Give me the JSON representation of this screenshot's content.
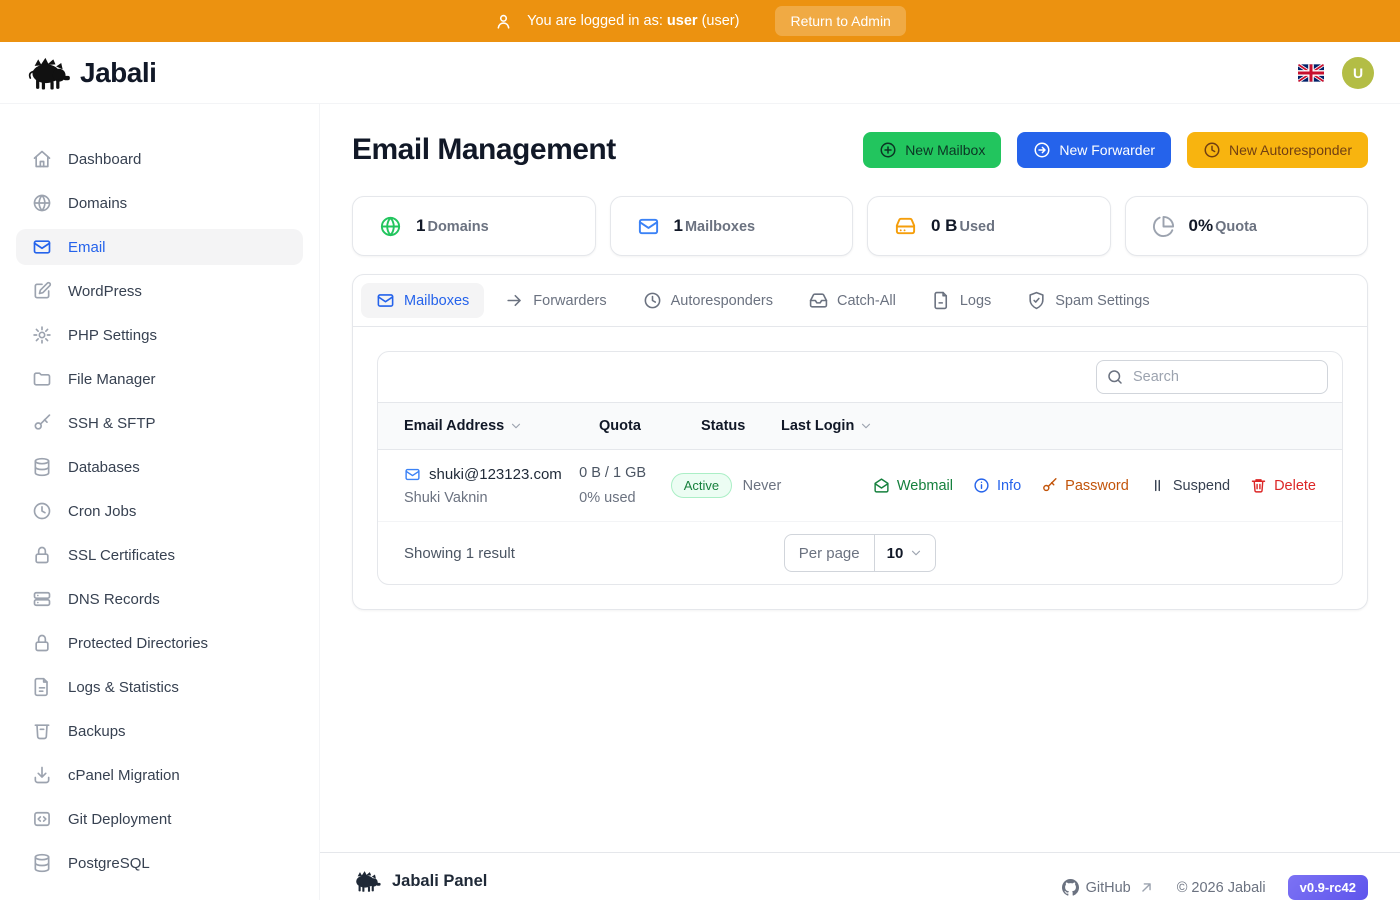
{
  "topbar": {
    "message_prefix": "You are logged in as:",
    "username": "user",
    "role_suffix": "(user)",
    "return_button": "Return to Admin"
  },
  "header": {
    "brand": "Jabali",
    "language_flag": "uk-flag",
    "avatar_initial": "U"
  },
  "sidebar": {
    "items": [
      {
        "label": "Dashboard",
        "icon": "home-icon",
        "active": false
      },
      {
        "label": "Domains",
        "icon": "globe-icon",
        "active": false
      },
      {
        "label": "Email",
        "icon": "mail-icon",
        "active": true
      },
      {
        "label": "WordPress",
        "icon": "edit-icon",
        "active": false
      },
      {
        "label": "PHP Settings",
        "icon": "gear-icon",
        "active": false
      },
      {
        "label": "File Manager",
        "icon": "folder-icon",
        "active": false
      },
      {
        "label": "SSH & SFTP",
        "icon": "key-icon",
        "active": false
      },
      {
        "label": "Databases",
        "icon": "database-icon",
        "active": false
      },
      {
        "label": "Cron Jobs",
        "icon": "clock-icon",
        "active": false
      },
      {
        "label": "SSL Certificates",
        "icon": "lock-icon",
        "active": false
      },
      {
        "label": "DNS Records",
        "icon": "server-icon",
        "active": false
      },
      {
        "label": "Protected Directories",
        "icon": "lock-icon",
        "active": false
      },
      {
        "label": "Logs & Statistics",
        "icon": "file-text-icon",
        "active": false
      },
      {
        "label": "Backups",
        "icon": "archive-icon",
        "active": false
      },
      {
        "label": "cPanel Migration",
        "icon": "download-icon",
        "active": false
      },
      {
        "label": "Git Deployment",
        "icon": "code-icon",
        "active": false
      },
      {
        "label": "PostgreSQL",
        "icon": "database-icon",
        "active": false
      }
    ]
  },
  "page": {
    "title": "Email Management",
    "actions": [
      {
        "label": "New Mailbox",
        "icon": "plus-circle-icon",
        "color": "#22C55E"
      },
      {
        "label": "New Forwarder",
        "icon": "arrow-right-circle-icon",
        "color": "#2563EB"
      },
      {
        "label": "New Autoresponder",
        "icon": "clock-icon",
        "color": "#F8B40F"
      }
    ]
  },
  "stats": [
    {
      "value": "1",
      "label": "Domains",
      "icon": "globe-icon",
      "icon_color": "#22C55E"
    },
    {
      "value": "1",
      "label": "Mailboxes",
      "icon": "mail-icon",
      "icon_color": "#3B82F6"
    },
    {
      "value": "0 B",
      "label": "Used",
      "icon": "hard-drive-icon",
      "icon_color": "#F59E0B"
    },
    {
      "value": "0%",
      "label": "Quota",
      "icon": "pie-chart-icon",
      "icon_color": "#9CA3AF"
    }
  ],
  "tabs": [
    {
      "label": "Mailboxes",
      "icon": "mail-icon",
      "active": true
    },
    {
      "label": "Forwarders",
      "icon": "arrow-right-icon",
      "active": false
    },
    {
      "label": "Autoresponders",
      "icon": "clock-icon",
      "active": false
    },
    {
      "label": "Catch-All",
      "icon": "inbox-icon",
      "active": false
    },
    {
      "label": "Logs",
      "icon": "file-icon",
      "active": false
    },
    {
      "label": "Spam Settings",
      "icon": "shield-check-icon",
      "active": false
    }
  ],
  "search": {
    "placeholder": "Search"
  },
  "table": {
    "columns": [
      "Email Address",
      "Quota",
      "Status",
      "Last Login"
    ],
    "rows": [
      {
        "email": "shuki@123123.com",
        "name": "Shuki Vaknin",
        "quota": "0 B / 1 GB",
        "quota_used": "0% used",
        "status": "Active",
        "last_login": "Never",
        "actions": [
          {
            "label": "Webmail",
            "icon": "mail-open-icon",
            "color": "#15803D"
          },
          {
            "label": "Info",
            "icon": "info-icon",
            "color": "#2563EB"
          },
          {
            "label": "Password",
            "icon": "key-icon",
            "color": "#C2540A"
          },
          {
            "label": "Suspend",
            "icon": "pause-icon",
            "color": "#374151"
          },
          {
            "label": "Delete",
            "icon": "trash-icon",
            "color": "#DC2626"
          }
        ]
      }
    ]
  },
  "pagination": {
    "showing": "Showing 1 result",
    "per_page_label": "Per page",
    "per_page_value": "10"
  },
  "footer": {
    "brand": "Jabali Panel",
    "github_label": "GitHub",
    "copyright": "© 2026 Jabali",
    "version": "v0.9-rc42"
  },
  "colors": {
    "topbar_orange": "#EC9210",
    "accent_blue": "#2563EB",
    "success_green": "#22C55E",
    "warning_amber": "#F8B40F",
    "avatar_olive": "#B3BD45",
    "status_badge_bg": "#ECFDF3",
    "status_badge_text": "#17803D",
    "version_badge_indigo": "#6D6AF0"
  }
}
